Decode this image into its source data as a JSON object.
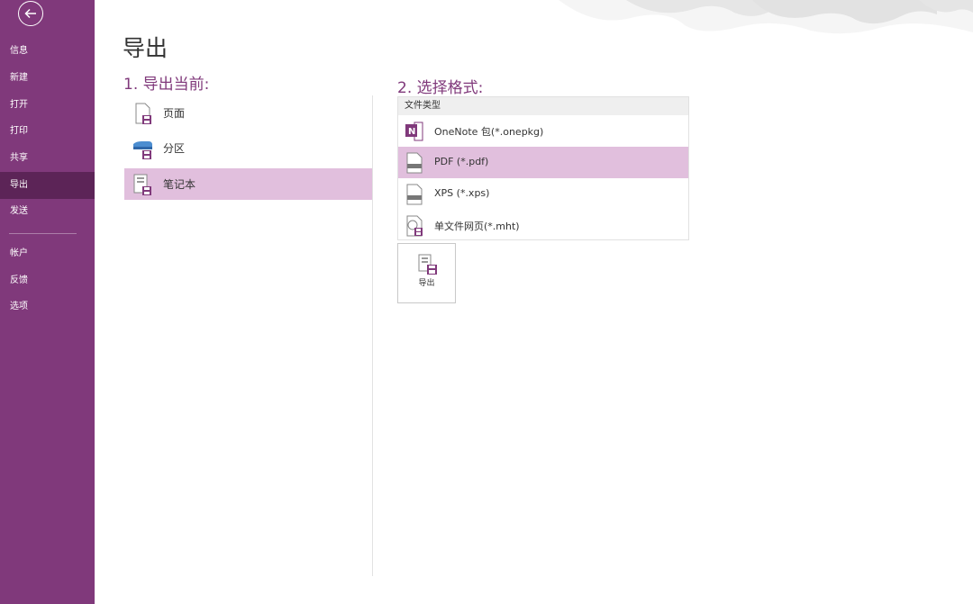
{
  "sidebar": {
    "back_icon": "back-arrow-icon",
    "items": [
      {
        "label": "信息"
      },
      {
        "label": "新建"
      },
      {
        "label": "打开"
      },
      {
        "label": "打印"
      },
      {
        "label": "共享"
      },
      {
        "label": "导出",
        "active": true
      },
      {
        "label": "发送"
      },
      {
        "label": "帐户"
      },
      {
        "label": "反馈"
      },
      {
        "label": "选项"
      }
    ]
  },
  "colors": {
    "sidebar_bg": "#80397b",
    "sidebar_active": "#5c2457",
    "accent": "#80397b",
    "selection": "#e1bfdd"
  },
  "page": {
    "title": "导出"
  },
  "export_current": {
    "heading": "1. 导出当前:",
    "items": [
      {
        "label": "页面",
        "icon": "page-icon"
      },
      {
        "label": "分区",
        "icon": "section-icon"
      },
      {
        "label": "笔记本",
        "icon": "notebook-icon",
        "selected": true
      }
    ]
  },
  "format": {
    "heading": "2. 选择格式:",
    "column_header": "文件类型",
    "items": [
      {
        "label": "OneNote 包(*.onepkg)",
        "icon": "onenote-icon"
      },
      {
        "label": "PDF (*.pdf)",
        "icon": "pdf-file-icon",
        "selected": true
      },
      {
        "label": "XPS (*.xps)",
        "icon": "xps-file-icon"
      },
      {
        "label": "单文件网页(*.mht)",
        "icon": "web-page-icon"
      }
    ]
  },
  "export_button": {
    "label": "导出",
    "icon": "export-icon"
  }
}
